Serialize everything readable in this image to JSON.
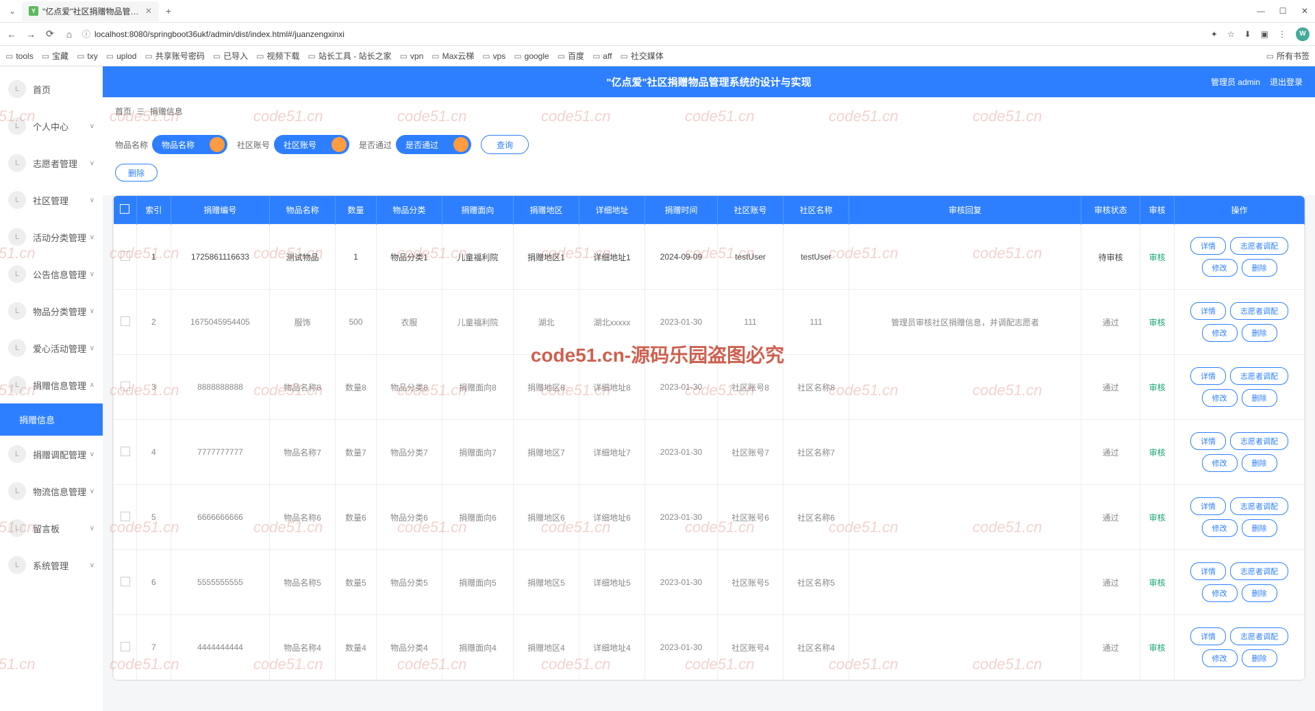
{
  "browser": {
    "tab_title": "\"亿点爱\"社区捐赠物品管理系统",
    "url": "localhost:8080/springboot36ukf/admin/dist/index.html#/juanzengxinxi",
    "bookmarks": [
      "tools",
      "宝藏",
      "txy",
      "uplod",
      "共享账号密码",
      "已导入",
      "视频下载",
      "站长工具 - 站长之家",
      "vpn",
      "Max云梯",
      "vps",
      "google",
      "百度",
      "aff",
      "社交媒体"
    ],
    "bookmarks_right": "所有书签",
    "avatar": "W"
  },
  "banner": {
    "title": "\"亿点爱\"社区捐赠物品管理系统的设计与实现",
    "role": "管理员 admin",
    "logout": "退出登录"
  },
  "sidebar": [
    {
      "label": "首页",
      "arrow": ""
    },
    {
      "label": "个人中心",
      "arrow": "∨"
    },
    {
      "label": "志愿者管理",
      "arrow": "∨"
    },
    {
      "label": "社区管理",
      "arrow": "∨"
    },
    {
      "label": "活动分类管理",
      "arrow": "∨"
    },
    {
      "label": "公告信息管理",
      "arrow": "∨"
    },
    {
      "label": "物品分类管理",
      "arrow": "∨"
    },
    {
      "label": "爱心活动管理",
      "arrow": "∨"
    },
    {
      "label": "捐赠信息管理",
      "arrow": "∧"
    },
    {
      "label": "捐赠信息",
      "arrow": "",
      "active": true,
      "sub": true
    },
    {
      "label": "捐赠调配管理",
      "arrow": "∨"
    },
    {
      "label": "物流信息管理",
      "arrow": "∨"
    },
    {
      "label": "留言板",
      "arrow": "∨"
    },
    {
      "label": "系统管理",
      "arrow": "∨"
    }
  ],
  "crumb": {
    "home": "首页",
    "icon": "☰",
    "current": "捐赠信息"
  },
  "filters": {
    "f1_label": "物品名称",
    "f1_ph": "物品名称",
    "f2_label": "社区账号",
    "f2_ph": "社区账号",
    "f3_label": "是否通过",
    "f3_ph": "是否通过",
    "query": "查询",
    "delete": "删除"
  },
  "table": {
    "headers": [
      "",
      "索引",
      "捐赠编号",
      "物品名称",
      "数量",
      "物品分类",
      "捐赠面向",
      "捐赠地区",
      "详细地址",
      "捐赠时间",
      "社区账号",
      "社区名称",
      "审核回复",
      "审核状态",
      "审核",
      "操作"
    ],
    "rows": [
      {
        "dark": true,
        "idx": "1",
        "code": "1725861116633",
        "name": "测试物品",
        "qty": "1",
        "cat": "物品分类1",
        "target": "儿童福利院",
        "region": "捐赠地区1",
        "addr": "详细地址1",
        "time": "2024-09-09",
        "acct": "testUser",
        "comm": "testUser",
        "reply": "",
        "status": "待审核",
        "audit": "审核"
      },
      {
        "idx": "2",
        "code": "1675045954405",
        "name": "服饰",
        "qty": "500",
        "cat": "衣服",
        "target": "儿童福利院",
        "region": "湖北",
        "addr": "湖北xxxxx",
        "time": "2023-01-30",
        "acct": "111",
        "comm": "111",
        "reply": "管理员审核社区捐赠信息，并调配志愿者",
        "status": "通过",
        "audit": "审核"
      },
      {
        "idx": "3",
        "code": "8888888888",
        "name": "物品名称8",
        "qty": "数量8",
        "cat": "物品分类8",
        "target": "捐赠面向8",
        "region": "捐赠地区8",
        "addr": "详细地址8",
        "time": "2023-01-30",
        "acct": "社区账号8",
        "comm": "社区名称8",
        "reply": "",
        "status": "通过",
        "audit": "审核"
      },
      {
        "idx": "4",
        "code": "7777777777",
        "name": "物品名称7",
        "qty": "数量7",
        "cat": "物品分类7",
        "target": "捐赠面向7",
        "region": "捐赠地区7",
        "addr": "详细地址7",
        "time": "2023-01-30",
        "acct": "社区账号7",
        "comm": "社区名称7",
        "reply": "",
        "status": "通过",
        "audit": "审核"
      },
      {
        "idx": "5",
        "code": "6666666666",
        "name": "物品名称6",
        "qty": "数量6",
        "cat": "物品分类6",
        "target": "捐赠面向6",
        "region": "捐赠地区6",
        "addr": "详细地址6",
        "time": "2023-01-30",
        "acct": "社区账号6",
        "comm": "社区名称6",
        "reply": "",
        "status": "通过",
        "audit": "审核"
      },
      {
        "idx": "6",
        "code": "5555555555",
        "name": "物品名称5",
        "qty": "数量5",
        "cat": "物品分类5",
        "target": "捐赠面向5",
        "region": "捐赠地区5",
        "addr": "详细地址5",
        "time": "2023-01-30",
        "acct": "社区账号5",
        "comm": "社区名称5",
        "reply": "",
        "status": "通过",
        "audit": "审核"
      },
      {
        "idx": "7",
        "code": "4444444444",
        "name": "物品名称4",
        "qty": "数量4",
        "cat": "物品分类4",
        "target": "捐赠面向4",
        "region": "捐赠地区4",
        "addr": "详细地址4",
        "time": "2023-01-30",
        "acct": "社区账号4",
        "comm": "社区名称4",
        "reply": "",
        "status": "通过",
        "audit": "审核"
      }
    ],
    "actions": {
      "detail": "详情",
      "assign": "志愿者调配",
      "edit": "修改",
      "del": "删除"
    }
  },
  "watermark": {
    "text": "code51.cn",
    "big": "code51.cn-源码乐园盗图必究"
  }
}
